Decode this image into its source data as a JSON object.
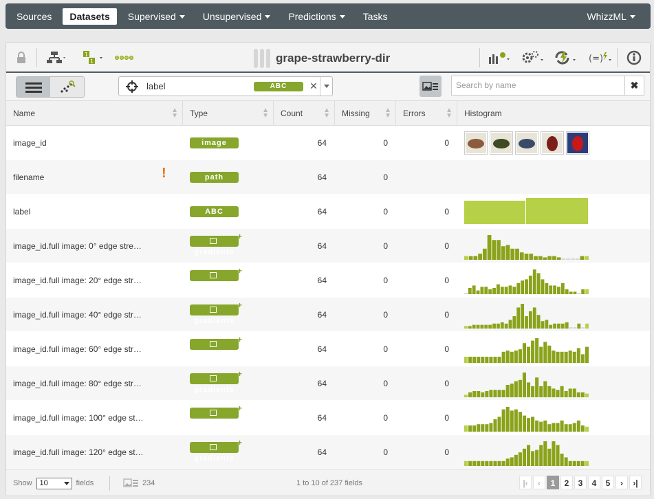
{
  "nav": {
    "items": [
      {
        "label": "Sources",
        "active": false,
        "dropdown": false
      },
      {
        "label": "Datasets",
        "active": true,
        "dropdown": false
      },
      {
        "label": "Supervised",
        "active": false,
        "dropdown": true
      },
      {
        "label": "Unsupervised",
        "active": false,
        "dropdown": true
      },
      {
        "label": "Predictions",
        "active": false,
        "dropdown": true
      },
      {
        "label": "Tasks",
        "active": false,
        "dropdown": false
      }
    ],
    "user": "WhizzML"
  },
  "dataset": {
    "title": "grape-strawberry-dir"
  },
  "filter": {
    "field_label": "label",
    "field_type": "ABC",
    "search_placeholder": "Search by name"
  },
  "columns": {
    "name": "Name",
    "type": "Type",
    "count": "Count",
    "missing": "Missing",
    "errors": "Errors",
    "histogram": "Histogram"
  },
  "rows": [
    {
      "name": "image_id",
      "type": "image",
      "count": "64",
      "missing": "0",
      "errors": "0",
      "kind": "thumbs",
      "warn": false
    },
    {
      "name": "filename",
      "type": "path",
      "count": "64",
      "missing": "0",
      "errors": "",
      "kind": "none",
      "warn": true
    },
    {
      "name": "label",
      "type": "ABC",
      "count": "64",
      "missing": "0",
      "errors": "0",
      "kind": "split",
      "warn": false
    },
    {
      "name": "image_id.full image: 0° edge stre…",
      "type": "gradients",
      "count": "64",
      "missing": "0",
      "errors": "0",
      "kind": "bars",
      "warn": false,
      "hist": [
        0.15,
        0.15,
        0.15,
        0.25,
        0.45,
        1,
        0.8,
        0.8,
        0.55,
        0.6,
        0.45,
        0.45,
        0.3,
        0.25,
        0.25,
        0.15,
        0.15,
        0.1,
        0.15,
        0.15,
        0.1,
        0.05,
        0.05,
        0.05,
        0.05,
        0.15,
        0.15
      ]
    },
    {
      "name": "image_id.full image: 20° edge str…",
      "type": "gradients",
      "count": "64",
      "missing": "0",
      "errors": "0",
      "kind": "bars",
      "warn": false,
      "hist": [
        0.05,
        0.25,
        0.35,
        0.15,
        0.3,
        0.3,
        0.2,
        0.25,
        0.4,
        0.3,
        0.3,
        0.35,
        0.3,
        0.45,
        0.55,
        0.6,
        0.75,
        1,
        0.85,
        0.6,
        0.45,
        0.35,
        0.35,
        0.3,
        0.45,
        0.2,
        0.1,
        0.1,
        0.05,
        0.2,
        0.2
      ]
    },
    {
      "name": "image_id.full image: 40° edge str…",
      "type": "gradients",
      "count": "64",
      "missing": "0",
      "errors": "0",
      "kind": "bars",
      "warn": false,
      "hist": [
        0.1,
        0.1,
        0.15,
        0.15,
        0.15,
        0.15,
        0.15,
        0.2,
        0.2,
        0.25,
        0.2,
        0.35,
        0.5,
        0.85,
        1,
        0.5,
        0.7,
        0.85,
        0.55,
        0.3,
        0.35,
        0.15,
        0.2,
        0.2,
        0.2,
        0.25,
        0.05,
        0.05,
        0.2,
        0.05,
        0.2
      ]
    },
    {
      "name": "image_id.full image: 60° edge str…",
      "type": "gradients",
      "count": "64",
      "missing": "0",
      "errors": "0",
      "kind": "bars",
      "warn": false,
      "hist": [
        0.25,
        0.25,
        0.25,
        0.25,
        0.25,
        0.25,
        0.25,
        0.25,
        0.25,
        0.45,
        0.5,
        0.45,
        0.5,
        0.55,
        0.8,
        0.65,
        0.9,
        1,
        0.65,
        0.85,
        0.7,
        0.5,
        0.45,
        0.45,
        0.45,
        0.5,
        0.45,
        0.6,
        0.35,
        0.65
      ]
    },
    {
      "name": "image_id.full image: 80° edge str…",
      "type": "gradients",
      "count": "64",
      "missing": "0",
      "errors": "0",
      "kind": "bars",
      "warn": false,
      "hist": [
        0.1,
        0.2,
        0.25,
        0.25,
        0.2,
        0.25,
        0.3,
        0.3,
        0.3,
        0.3,
        0.5,
        0.55,
        0.65,
        0.7,
        1,
        0.6,
        0.45,
        0.8,
        0.45,
        0.65,
        0.45,
        0.35,
        0.3,
        0.45,
        0.25,
        0.35,
        0.35,
        0.2,
        0.2,
        0.15
      ]
    },
    {
      "name": "image_id.full image: 100° edge st…",
      "type": "gradients",
      "count": "64",
      "missing": "0",
      "errors": "0",
      "kind": "bars",
      "warn": false,
      "hist": [
        0.25,
        0.25,
        0.25,
        0.3,
        0.3,
        0.3,
        0.35,
        0.5,
        0.6,
        0.9,
        1,
        0.85,
        0.9,
        0.8,
        0.65,
        0.55,
        0.6,
        0.45,
        0.4,
        0.45,
        0.3,
        0.35,
        0.35,
        0.45,
        0.3,
        0.3,
        0.35,
        0.45,
        0.25,
        0.2
      ]
    },
    {
      "name": "image_id.full image: 120° edge st…",
      "type": "gradients",
      "count": "64",
      "missing": "0",
      "errors": "0",
      "kind": "bars",
      "warn": false,
      "hist": [
        0.2,
        0.2,
        0.2,
        0.2,
        0.2,
        0.2,
        0.2,
        0.2,
        0.2,
        0.2,
        0.3,
        0.35,
        0.45,
        0.55,
        0.7,
        0.85,
        0.6,
        0.65,
        0.85,
        1,
        0.7,
        1,
        0.85,
        0.5,
        0.35,
        0.2,
        0.2,
        0.2,
        0.2,
        0.2
      ]
    }
  ],
  "footer": {
    "show_label": "Show",
    "per_page": "10",
    "fields_label": "fields",
    "image_count": "234",
    "range_text": "1 to 10 of 237 fields",
    "pages": [
      "1",
      "2",
      "3",
      "4",
      "5"
    ],
    "current_page": "1"
  },
  "colors": {
    "nav_bg": "#4f5a60",
    "accent": "#86a62c",
    "hist_bar": "#8aa31b",
    "hist_light": "#b6d048",
    "warn": "#e8731a"
  },
  "icons": [
    "lock-icon",
    "model-tree-icon",
    "dataset-digits-icon",
    "dots-icon",
    "histogram-settings-icon",
    "gears-icon",
    "lightning-cycle-icon",
    "formula-icon",
    "info-icon",
    "list-view-icon",
    "scatter-view-icon",
    "crosshair-icon",
    "image-list-icon",
    "close-icon"
  ]
}
